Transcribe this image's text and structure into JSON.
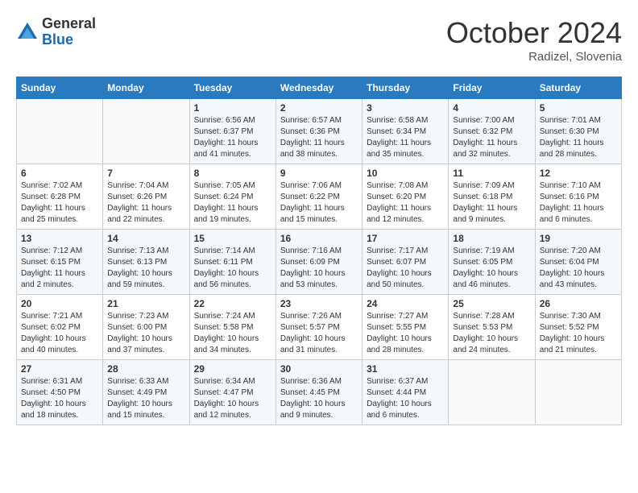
{
  "header": {
    "logo_general": "General",
    "logo_blue": "Blue",
    "month_title": "October 2024",
    "location": "Radizel, Slovenia"
  },
  "weekdays": [
    "Sunday",
    "Monday",
    "Tuesday",
    "Wednesday",
    "Thursday",
    "Friday",
    "Saturday"
  ],
  "weeks": [
    [
      {
        "day": "",
        "sunrise": "",
        "sunset": "",
        "daylight": ""
      },
      {
        "day": "",
        "sunrise": "",
        "sunset": "",
        "daylight": ""
      },
      {
        "day": "1",
        "sunrise": "Sunrise: 6:56 AM",
        "sunset": "Sunset: 6:37 PM",
        "daylight": "Daylight: 11 hours and 41 minutes."
      },
      {
        "day": "2",
        "sunrise": "Sunrise: 6:57 AM",
        "sunset": "Sunset: 6:36 PM",
        "daylight": "Daylight: 11 hours and 38 minutes."
      },
      {
        "day": "3",
        "sunrise": "Sunrise: 6:58 AM",
        "sunset": "Sunset: 6:34 PM",
        "daylight": "Daylight: 11 hours and 35 minutes."
      },
      {
        "day": "4",
        "sunrise": "Sunrise: 7:00 AM",
        "sunset": "Sunset: 6:32 PM",
        "daylight": "Daylight: 11 hours and 32 minutes."
      },
      {
        "day": "5",
        "sunrise": "Sunrise: 7:01 AM",
        "sunset": "Sunset: 6:30 PM",
        "daylight": "Daylight: 11 hours and 28 minutes."
      }
    ],
    [
      {
        "day": "6",
        "sunrise": "Sunrise: 7:02 AM",
        "sunset": "Sunset: 6:28 PM",
        "daylight": "Daylight: 11 hours and 25 minutes."
      },
      {
        "day": "7",
        "sunrise": "Sunrise: 7:04 AM",
        "sunset": "Sunset: 6:26 PM",
        "daylight": "Daylight: 11 hours and 22 minutes."
      },
      {
        "day": "8",
        "sunrise": "Sunrise: 7:05 AM",
        "sunset": "Sunset: 6:24 PM",
        "daylight": "Daylight: 11 hours and 19 minutes."
      },
      {
        "day": "9",
        "sunrise": "Sunrise: 7:06 AM",
        "sunset": "Sunset: 6:22 PM",
        "daylight": "Daylight: 11 hours and 15 minutes."
      },
      {
        "day": "10",
        "sunrise": "Sunrise: 7:08 AM",
        "sunset": "Sunset: 6:20 PM",
        "daylight": "Daylight: 11 hours and 12 minutes."
      },
      {
        "day": "11",
        "sunrise": "Sunrise: 7:09 AM",
        "sunset": "Sunset: 6:18 PM",
        "daylight": "Daylight: 11 hours and 9 minutes."
      },
      {
        "day": "12",
        "sunrise": "Sunrise: 7:10 AM",
        "sunset": "Sunset: 6:16 PM",
        "daylight": "Daylight: 11 hours and 6 minutes."
      }
    ],
    [
      {
        "day": "13",
        "sunrise": "Sunrise: 7:12 AM",
        "sunset": "Sunset: 6:15 PM",
        "daylight": "Daylight: 11 hours and 2 minutes."
      },
      {
        "day": "14",
        "sunrise": "Sunrise: 7:13 AM",
        "sunset": "Sunset: 6:13 PM",
        "daylight": "Daylight: 10 hours and 59 minutes."
      },
      {
        "day": "15",
        "sunrise": "Sunrise: 7:14 AM",
        "sunset": "Sunset: 6:11 PM",
        "daylight": "Daylight: 10 hours and 56 minutes."
      },
      {
        "day": "16",
        "sunrise": "Sunrise: 7:16 AM",
        "sunset": "Sunset: 6:09 PM",
        "daylight": "Daylight: 10 hours and 53 minutes."
      },
      {
        "day": "17",
        "sunrise": "Sunrise: 7:17 AM",
        "sunset": "Sunset: 6:07 PM",
        "daylight": "Daylight: 10 hours and 50 minutes."
      },
      {
        "day": "18",
        "sunrise": "Sunrise: 7:19 AM",
        "sunset": "Sunset: 6:05 PM",
        "daylight": "Daylight: 10 hours and 46 minutes."
      },
      {
        "day": "19",
        "sunrise": "Sunrise: 7:20 AM",
        "sunset": "Sunset: 6:04 PM",
        "daylight": "Daylight: 10 hours and 43 minutes."
      }
    ],
    [
      {
        "day": "20",
        "sunrise": "Sunrise: 7:21 AM",
        "sunset": "Sunset: 6:02 PM",
        "daylight": "Daylight: 10 hours and 40 minutes."
      },
      {
        "day": "21",
        "sunrise": "Sunrise: 7:23 AM",
        "sunset": "Sunset: 6:00 PM",
        "daylight": "Daylight: 10 hours and 37 minutes."
      },
      {
        "day": "22",
        "sunrise": "Sunrise: 7:24 AM",
        "sunset": "Sunset: 5:58 PM",
        "daylight": "Daylight: 10 hours and 34 minutes."
      },
      {
        "day": "23",
        "sunrise": "Sunrise: 7:26 AM",
        "sunset": "Sunset: 5:57 PM",
        "daylight": "Daylight: 10 hours and 31 minutes."
      },
      {
        "day": "24",
        "sunrise": "Sunrise: 7:27 AM",
        "sunset": "Sunset: 5:55 PM",
        "daylight": "Daylight: 10 hours and 28 minutes."
      },
      {
        "day": "25",
        "sunrise": "Sunrise: 7:28 AM",
        "sunset": "Sunset: 5:53 PM",
        "daylight": "Daylight: 10 hours and 24 minutes."
      },
      {
        "day": "26",
        "sunrise": "Sunrise: 7:30 AM",
        "sunset": "Sunset: 5:52 PM",
        "daylight": "Daylight: 10 hours and 21 minutes."
      }
    ],
    [
      {
        "day": "27",
        "sunrise": "Sunrise: 6:31 AM",
        "sunset": "Sunset: 4:50 PM",
        "daylight": "Daylight: 10 hours and 18 minutes."
      },
      {
        "day": "28",
        "sunrise": "Sunrise: 6:33 AM",
        "sunset": "Sunset: 4:49 PM",
        "daylight": "Daylight: 10 hours and 15 minutes."
      },
      {
        "day": "29",
        "sunrise": "Sunrise: 6:34 AM",
        "sunset": "Sunset: 4:47 PM",
        "daylight": "Daylight: 10 hours and 12 minutes."
      },
      {
        "day": "30",
        "sunrise": "Sunrise: 6:36 AM",
        "sunset": "Sunset: 4:45 PM",
        "daylight": "Daylight: 10 hours and 9 minutes."
      },
      {
        "day": "31",
        "sunrise": "Sunrise: 6:37 AM",
        "sunset": "Sunset: 4:44 PM",
        "daylight": "Daylight: 10 hours and 6 minutes."
      },
      {
        "day": "",
        "sunrise": "",
        "sunset": "",
        "daylight": ""
      },
      {
        "day": "",
        "sunrise": "",
        "sunset": "",
        "daylight": ""
      }
    ]
  ]
}
